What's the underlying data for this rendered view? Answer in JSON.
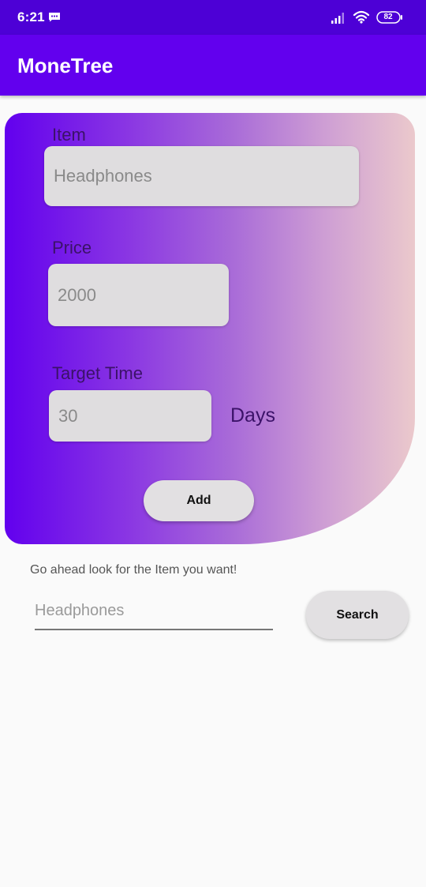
{
  "status_bar": {
    "time": "6:21",
    "battery": "82",
    "icons": [
      "message-icon",
      "signal-icon",
      "wifi-icon",
      "battery-icon"
    ]
  },
  "app_bar": {
    "title": "MoneTree"
  },
  "form": {
    "item_label": "Item",
    "item_placeholder": "Headphones",
    "price_label": "Price",
    "price_placeholder": "2000",
    "target_label": "Target Time",
    "target_placeholder": "30",
    "days_label": "Days",
    "add_label": "Add"
  },
  "search": {
    "prompt": "Go ahead look for the Item you want!",
    "placeholder": "Headphones",
    "button_label": "Search"
  },
  "colors": {
    "status_bar": "#4d00d6",
    "app_bar": "#6200ee",
    "gradient_start": "#6200ee",
    "gradient_end": "#ebc9cc",
    "field_bg": "#dfdddf",
    "background": "#fafafa"
  }
}
